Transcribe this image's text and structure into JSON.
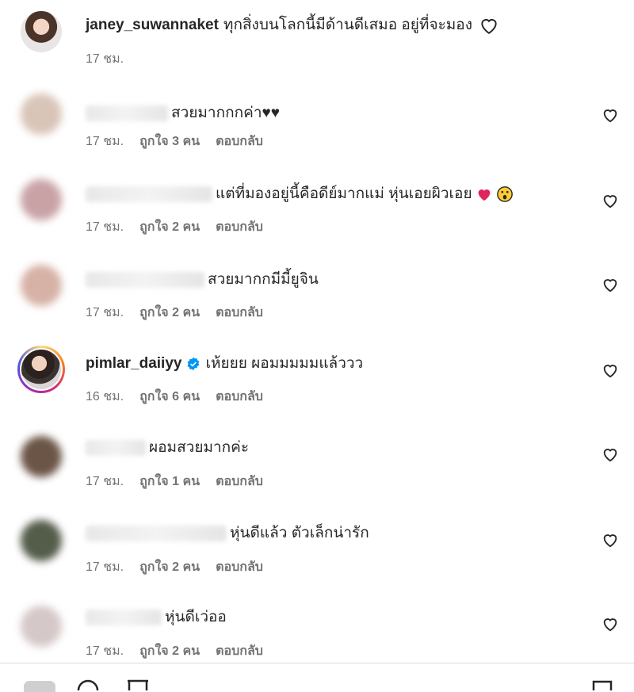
{
  "caption": {
    "username": "janey_suwannaket",
    "text": "ทุกสิ่งบนโลกนี้มีด้านดีเสมอ อยู่ที่จะมอง",
    "time": "17 ชม.",
    "heart_icon": "heart-outline-icon"
  },
  "labels": {
    "reply": "ตอบกลับ"
  },
  "comments": [
    {
      "username": "",
      "text": "สวยมากกกค่า♥♥",
      "time": "17 ชม.",
      "likes": "ถูกใจ 3 คน"
    },
    {
      "username": "",
      "text": "แต่ที่มองอยู่นี้คือดีย์มากแม่ หุ่นเอยผิวเอย",
      "time": "17 ชม.",
      "likes": "ถูกใจ 2 คน"
    },
    {
      "username": "",
      "text": "สวยมากกมีมี้ยูจิน",
      "time": "17 ชม.",
      "likes": "ถูกใจ 2 คน"
    },
    {
      "username": "pimlar_daiiyy",
      "text": "เห้ยยย ผอมมมมมแล้ววว",
      "time": "16 ชม.",
      "likes": "ถูกใจ 6 คน",
      "verified": true
    },
    {
      "username": "",
      "text": "ผอมสวยมากค่ะ",
      "time": "17 ชม.",
      "likes": "ถูกใจ 1 คน"
    },
    {
      "username": "",
      "text": "หุ่นดีแล้ว ตัวเล็กน่ารัก",
      "time": "17 ชม.",
      "likes": "ถูกใจ 2 คน"
    },
    {
      "username": "",
      "text": "หุ่นดีเว่ออ",
      "time": "17 ชม.",
      "likes": "ถูกใจ 2 คน"
    }
  ],
  "colors": {
    "text": "#262626",
    "meta": "#737373",
    "verified": "#0095f6",
    "red_heart": "#e0245e"
  }
}
